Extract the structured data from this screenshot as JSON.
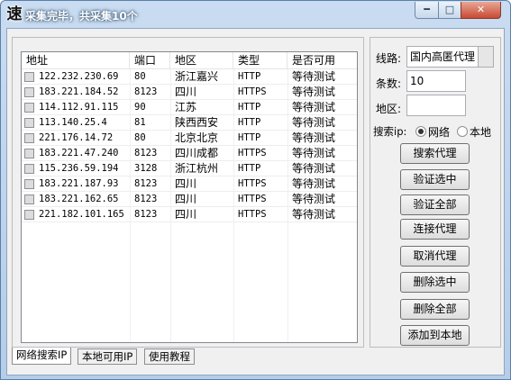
{
  "window": {
    "app_icon": "速",
    "title": "采集完毕，共采集10个",
    "min_glyph": "━",
    "max_glyph": "□",
    "close_glyph": "✕"
  },
  "list": {
    "headers": [
      "地址",
      "端口",
      "地区",
      "类型",
      "是否可用"
    ],
    "rows": [
      {
        "address": "122.232.230.69",
        "port": "80",
        "region": "浙江嘉兴",
        "type": "HTTP",
        "status": "等待测试"
      },
      {
        "address": "183.221.184.52",
        "port": "8123",
        "region": "四川",
        "type": "HTTPS",
        "status": "等待测试"
      },
      {
        "address": "114.112.91.115",
        "port": "90",
        "region": "江苏",
        "type": "HTTP",
        "status": "等待测试"
      },
      {
        "address": "113.140.25.4",
        "port": "81",
        "region": "陕西西安",
        "type": "HTTP",
        "status": "等待测试"
      },
      {
        "address": "221.176.14.72",
        "port": "80",
        "region": "北京北京",
        "type": "HTTP",
        "status": "等待测试"
      },
      {
        "address": "183.221.47.240",
        "port": "8123",
        "region": "四川成都",
        "type": "HTTPS",
        "status": "等待测试"
      },
      {
        "address": "115.236.59.194",
        "port": "3128",
        "region": "浙江杭州",
        "type": "HTTP",
        "status": "等待测试"
      },
      {
        "address": "183.221.187.93",
        "port": "8123",
        "region": "四川",
        "type": "HTTPS",
        "status": "等待测试"
      },
      {
        "address": "183.221.162.65",
        "port": "8123",
        "region": "四川",
        "type": "HTTPS",
        "status": "等待测试"
      },
      {
        "address": "221.182.101.165",
        "port": "8123",
        "region": "四川",
        "type": "HTTPS",
        "status": "等待测试"
      }
    ]
  },
  "tabs": [
    "网络搜索IP",
    "本地可用IP",
    "使用教程"
  ],
  "panel": {
    "line_label": "线路:",
    "line_value": "国内高匿代理",
    "count_label": "条数:",
    "count_value": "10",
    "region_label": "地区:",
    "region_value": "",
    "search_ip_label": "搜索ip:",
    "radio_network": "网络",
    "radio_local": "本地",
    "buttons": [
      "搜索代理",
      "验证选中",
      "验证全部",
      "连接代理",
      "取消代理",
      "删除选中",
      "删除全部",
      "添加到本地"
    ]
  }
}
